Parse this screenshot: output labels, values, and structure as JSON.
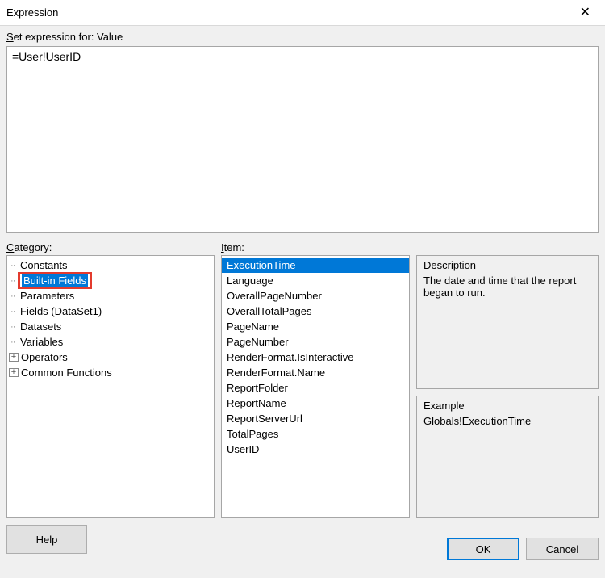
{
  "title": "Expression",
  "set_expression_label_pre": "Set expression for: ",
  "set_expression_label_field": "Value",
  "expression_text": "=User!UserID",
  "labels": {
    "category": "Category:",
    "item": "Item:",
    "description": "Description",
    "example": "Example"
  },
  "category_tree": [
    {
      "label": "Constants",
      "leaf": true
    },
    {
      "label": "Built-in Fields",
      "leaf": true,
      "selected": true,
      "highlighted": true
    },
    {
      "label": "Parameters",
      "leaf": true
    },
    {
      "label": "Fields (DataSet1)",
      "leaf": true
    },
    {
      "label": "Datasets",
      "leaf": true
    },
    {
      "label": "Variables",
      "leaf": true
    },
    {
      "label": "Operators",
      "expandable": true
    },
    {
      "label": "Common Functions",
      "expandable": true
    }
  ],
  "items": [
    {
      "label": "ExecutionTime",
      "selected": true
    },
    {
      "label": "Language"
    },
    {
      "label": "OverallPageNumber"
    },
    {
      "label": "OverallTotalPages"
    },
    {
      "label": "PageName"
    },
    {
      "label": "PageNumber"
    },
    {
      "label": "RenderFormat.IsInteractive"
    },
    {
      "label": "RenderFormat.Name"
    },
    {
      "label": "ReportFolder"
    },
    {
      "label": "ReportName"
    },
    {
      "label": "ReportServerUrl"
    },
    {
      "label": "TotalPages"
    },
    {
      "label": "UserID"
    }
  ],
  "description_text": "The date and time that the report began to run.",
  "example_text": "Globals!ExecutionTime",
  "buttons": {
    "help": "Help",
    "ok": "OK",
    "cancel": "Cancel"
  }
}
